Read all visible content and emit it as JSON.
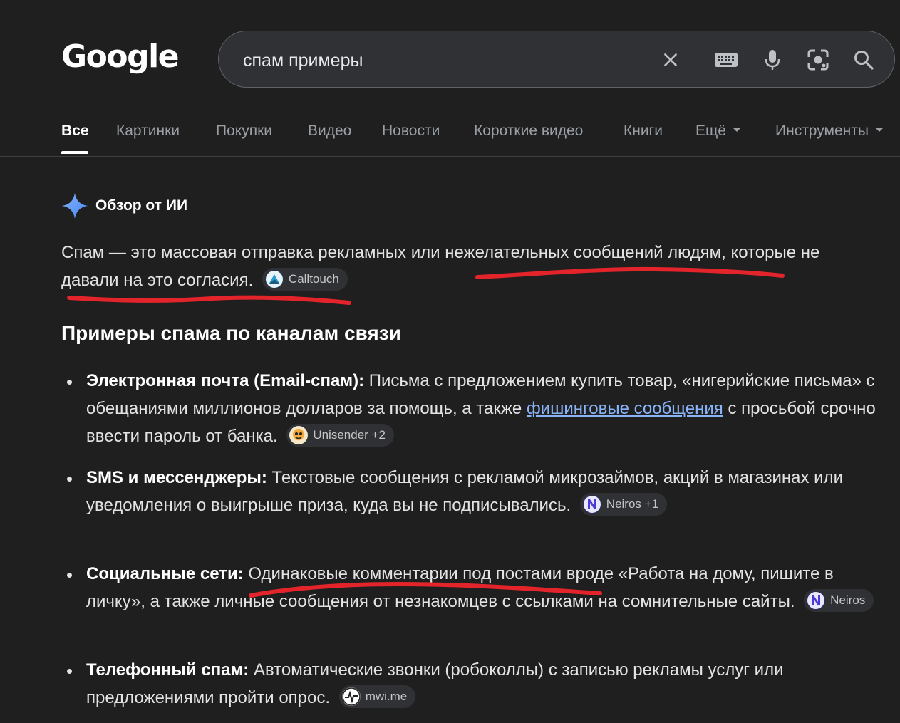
{
  "logo": "Google",
  "search": {
    "query": "спам примеры"
  },
  "tabs": [
    "Все",
    "Картинки",
    "Покупки",
    "Видео",
    "Новости",
    "Короткие видео",
    "Книги",
    "Ещё",
    "Инструменты"
  ],
  "ai_overview": {
    "title": "Обзор от ИИ",
    "intro": "Спам — это массовая отправка рекламных или нежелательных сообщений людям, которые не давали на это согласия.",
    "intro_source": "Calltouch"
  },
  "section_title": "Примеры спама по каналам связи",
  "items": [
    {
      "label": "Электронная почта (Email-спам):",
      "text_before": "Письма с предложением купить товар, «нигерийские письма» с обещаниями миллионов долларов за помощь, а также",
      "link": "фишинговые сообщения",
      "text_after": "с просьбой срочно ввести пароль от банка.",
      "source": "Unisender +2"
    },
    {
      "label": "SMS и мессенджеры:",
      "text": "Текстовые сообщения с рекламой микрозаймов, акций в магазинах или уведомления о выигрыше приза, куда вы не подписывались.",
      "source": "Neiros +1"
    },
    {
      "label": "Социальные сети:",
      "text": "Одинаковые комментарии под постами вроде «Работа на дому, пишите в личку», а также личные сообщения от незнакомцев с ссылками на сомнительные сайты.",
      "source": "Neiros"
    },
    {
      "label": "Телефонный спам:",
      "text": "Автоматические звонки (робоколлы) с записью рекламы услуг или предложениями пройти опрос.",
      "source": "mwi.me"
    }
  ],
  "colors": {
    "background": "#1f1f1f",
    "link": "#8ab4f8",
    "annotation": "#e3242b",
    "chip": "#303134"
  }
}
